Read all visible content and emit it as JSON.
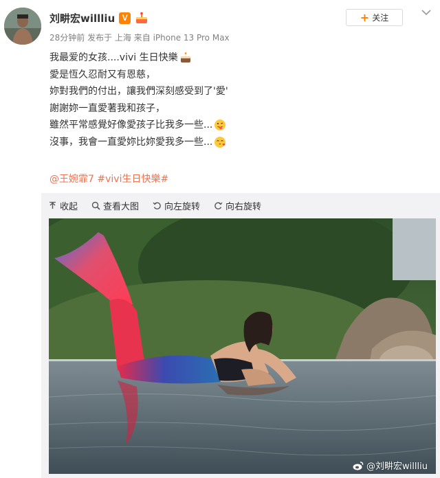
{
  "user": {
    "name": "刘畊宏willliu",
    "verified_badge": "V",
    "avatar_icon": "avatar-photo",
    "badge_icon": "cake-badge-icon"
  },
  "meta": {
    "time": "28分钟前",
    "location": "发布于 上海",
    "source": "来自 iPhone 13 Pro Max"
  },
  "follow": {
    "label": "关注",
    "plus": "+"
  },
  "post": {
    "lines": [
      "我最爱的女孩....vivi 生日快樂",
      "愛是恆久忍耐又有恩慈，",
      "妳對我們的付出，讓我們深刻感受到了'愛'",
      "謝謝妳一直愛著我和孩子，",
      "雖然平常感覺好像愛孩子比我多一些...",
      "沒事，我會一直愛妳比妳愛我多一些..."
    ],
    "emoji": [
      "cake-emoji",
      "tongue-emoji",
      "heart-kiss-emoji"
    ]
  },
  "tags": {
    "mention": "@王婉霏7",
    "topic": "#vivi生日快樂#"
  },
  "toolbar": {
    "collapse": "收起",
    "view_full": "查看大图",
    "rotate_left": "向左旋转",
    "rotate_right": "向右旋转"
  },
  "watermark": "@刘畊宏willliu",
  "colors": {
    "accent": "#ff8200",
    "link": "#eb7350",
    "meta": "#808080",
    "panel": "#f2f2f5"
  }
}
